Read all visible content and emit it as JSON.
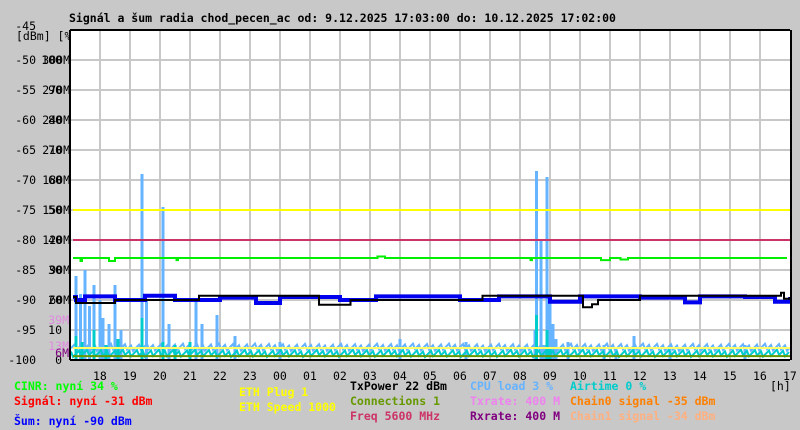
{
  "title": "Signál a šum radia chod_pecen_ac od: 9.12.2025 17:03:00 do: 10.12.2025 17:02:00",
  "chart_data": {
    "type": "line",
    "title": "Signál a šum radia chod_pecen_ac od: 9.12.2025 17:03:00 do: 10.12.2025 17:02:00",
    "y_unit_label": "[dBm] [%]",
    "x_unit_label": "[h]",
    "ylim_dbm": [
      -100,
      -45
    ],
    "ylim_percent": [
      0,
      100
    ],
    "grid": true,
    "y_ticks": [
      {
        "dbm": "-45",
        "pct": "",
        "rate": ""
      },
      {
        "dbm": "-50",
        "pct": "100",
        "rate": "300M"
      },
      {
        "dbm": "-55",
        "pct": "90",
        "rate": "270M"
      },
      {
        "dbm": "-60",
        "pct": "80",
        "rate": "240M"
      },
      {
        "dbm": "-65",
        "pct": "70",
        "rate": "210M"
      },
      {
        "dbm": "-70",
        "pct": "60",
        "rate": "180M"
      },
      {
        "dbm": "-75",
        "pct": "50",
        "rate": "150M"
      },
      {
        "dbm": "-80",
        "pct": "40",
        "rate": "120M"
      },
      {
        "dbm": "-85",
        "pct": "30",
        "rate": "90M"
      },
      {
        "dbm": "-90",
        "pct": "20",
        "rate": "60M"
      },
      {
        "dbm": "-95",
        "pct": "10",
        "rate": ""
      },
      {
        "dbm": "-100",
        "pct": "0",
        "rate": ""
      }
    ],
    "extra_rate_ticks": [
      {
        "label": "39M",
        "pct": 13,
        "color": "#e08ae0"
      },
      {
        "label": "13M",
        "pct": 4.3,
        "color": "#e08ae0"
      },
      {
        "label": "6M",
        "pct": 2,
        "color": "#800080"
      }
    ],
    "x_ticks": [
      "18",
      "19",
      "20",
      "21",
      "22",
      "23",
      "00",
      "01",
      "02",
      "03",
      "04",
      "05",
      "06",
      "07",
      "08",
      "09",
      "10",
      "11",
      "12",
      "13",
      "14",
      "15",
      "16",
      "17"
    ],
    "x_start_hour_offset": 0.1,
    "series": [
      {
        "name": "ETH Plug",
        "axis": "dbm",
        "color": "#ffff00",
        "points": [
          [
            0.1,
            -75
          ],
          [
            24,
            -75
          ]
        ]
      },
      {
        "name": "Freq",
        "axis": "dbm",
        "color": "#cc3366",
        "points": [
          [
            0.1,
            -80
          ],
          [
            24,
            -80
          ]
        ]
      },
      {
        "name": "CINR",
        "axis": "pct",
        "color": "#00ee00",
        "points": [
          [
            0.1,
            34
          ],
          [
            0.3,
            34
          ],
          [
            0.35,
            33
          ],
          [
            0.4,
            34
          ],
          [
            1.2,
            34
          ],
          [
            1.3,
            33
          ],
          [
            1.5,
            34
          ],
          [
            3.5,
            34
          ],
          [
            3.55,
            33.3
          ],
          [
            3.6,
            34
          ],
          [
            10.2,
            34
          ],
          [
            10.25,
            34.5
          ],
          [
            10.5,
            34
          ],
          [
            15.3,
            34
          ],
          [
            15.35,
            33.3
          ],
          [
            15.4,
            34
          ],
          [
            17.6,
            34
          ],
          [
            17.7,
            33.3
          ],
          [
            18.0,
            34
          ],
          [
            18.3,
            34
          ],
          [
            18.35,
            33.5
          ],
          [
            18.6,
            34
          ],
          [
            23.9,
            34
          ]
        ]
      },
      {
        "name": "Šum",
        "axis": "dbm",
        "color": "#0000ee",
        "points": [
          [
            0.1,
            -89.5
          ],
          [
            0.2,
            -90
          ],
          [
            0.5,
            -89.4
          ],
          [
            1.5,
            -90
          ],
          [
            2.5,
            -89.3
          ],
          [
            3.5,
            -90
          ],
          [
            5.0,
            -89.6
          ],
          [
            6.2,
            -90.5
          ],
          [
            7.0,
            -89.5
          ],
          [
            9.0,
            -90
          ],
          [
            10.2,
            -89.4
          ],
          [
            12.5,
            -89.4
          ],
          [
            13.0,
            -90
          ],
          [
            14.3,
            -89.4
          ],
          [
            16.0,
            -90.3
          ],
          [
            17.0,
            -89.4
          ],
          [
            19.0,
            -89.6
          ],
          [
            20.5,
            -90.4
          ],
          [
            21.0,
            -89.4
          ],
          [
            22.5,
            -89.5
          ],
          [
            23.5,
            -90.3
          ],
          [
            24,
            -89.5
          ]
        ]
      },
      {
        "name": "TxPower",
        "axis": "dbm",
        "color": "#000000",
        "points": [
          [
            0.1,
            -89.5
          ],
          [
            0.2,
            -90.5
          ],
          [
            1.0,
            -90.5
          ],
          [
            1.5,
            -90
          ],
          [
            3.5,
            -90
          ],
          [
            4.3,
            -89.3
          ],
          [
            8.2,
            -89.3
          ],
          [
            8.3,
            -90.8
          ],
          [
            9.3,
            -90.8
          ],
          [
            9.35,
            -90
          ],
          [
            13.7,
            -90
          ],
          [
            13.75,
            -89.3
          ],
          [
            17.0,
            -89.3
          ],
          [
            17.1,
            -91.2
          ],
          [
            17.4,
            -90.7
          ],
          [
            17.6,
            -90
          ],
          [
            18.8,
            -90
          ],
          [
            19.0,
            -89.3
          ],
          [
            23.6,
            -89.3
          ],
          [
            23.7,
            -88.8
          ],
          [
            23.8,
            -89.8
          ],
          [
            24,
            -89.5
          ]
        ]
      },
      {
        "name": "Connections",
        "axis": "pct",
        "color": "#669900",
        "points": [
          [
            0.1,
            1.3
          ],
          [
            24,
            1.3
          ]
        ]
      },
      {
        "name": "ETH Speed",
        "axis": "pct",
        "color": "#ffff66",
        "points": [
          [
            0.1,
            4
          ],
          [
            24,
            4
          ]
        ]
      }
    ],
    "bars": [
      {
        "name": "CPU load",
        "color": "#66b3ff",
        "baseline": 3,
        "spikes": [
          [
            0.2,
            28
          ],
          [
            0.35,
            22
          ],
          [
            0.5,
            30
          ],
          [
            0.65,
            18
          ],
          [
            0.8,
            25
          ],
          [
            1.0,
            20
          ],
          [
            1.1,
            14
          ],
          [
            1.3,
            12
          ],
          [
            1.5,
            25
          ],
          [
            1.7,
            10
          ],
          [
            2.4,
            62
          ],
          [
            2.55,
            20
          ],
          [
            3.1,
            51
          ],
          [
            3.3,
            12
          ],
          [
            4.2,
            20
          ],
          [
            4.4,
            12
          ],
          [
            4.9,
            15
          ],
          [
            5.5,
            8
          ],
          [
            7.0,
            6
          ],
          [
            11.0,
            7
          ],
          [
            13.2,
            6
          ],
          [
            15.5,
            8
          ],
          [
            15.8,
            5
          ],
          [
            15.5,
            10
          ],
          [
            16.2,
            7
          ],
          [
            16.6,
            6
          ],
          [
            15.9,
            4
          ],
          [
            17.8,
            5
          ],
          [
            18.2,
            4
          ],
          [
            15.55,
            63
          ],
          [
            15.7,
            40
          ],
          [
            15.9,
            61
          ],
          [
            16.0,
            20
          ],
          [
            16.1,
            12
          ],
          [
            18.8,
            8
          ],
          [
            20.0,
            5
          ],
          [
            22.5,
            5
          ]
        ]
      },
      {
        "name": "Airtime",
        "color": "#00cccc",
        "baseline": 1,
        "spikes": [
          [
            0.2,
            8
          ],
          [
            0.4,
            6
          ],
          [
            0.8,
            10
          ],
          [
            1.2,
            5
          ],
          [
            1.6,
            7
          ],
          [
            2.4,
            14
          ],
          [
            3.1,
            6
          ],
          [
            3.5,
            5
          ],
          [
            4.0,
            6
          ],
          [
            15.55,
            15
          ],
          [
            15.9,
            10
          ],
          [
            16.0,
            4
          ]
        ]
      }
    ]
  },
  "legend": {
    "cinr": "CINR: nyní 34 %",
    "signal": "Signál: nyní -31 dBm",
    "noise": "Šum: nyní -90 dBm",
    "eth_plug": "ETH Plug 1",
    "eth_speed": "ETH Speed 1000",
    "txpower": "TxPower 22 dBm",
    "connections": "Connections 1",
    "freq": "Freq 5600 MHz",
    "cpu": "CPU load 3 %",
    "txrate": "Txrate: 400 M",
    "rxrate": "Rxrate: 400 M",
    "airtime": "Airtime 0 %",
    "chain0": "Chain0 signal -35 dBm",
    "chain1": "Chain1 signal -34 dBm"
  },
  "colors": {
    "cinr": "#00ff00",
    "signal": "#ff0000",
    "noise": "#0000ff",
    "eth": "#ffff00",
    "txpower": "#000000",
    "connections": "#669900",
    "freq": "#cc3366",
    "cpu": "#66b3ff",
    "txrate": "#ee82ee",
    "rxrate": "#800080",
    "airtime": "#00cccc",
    "chain0": "#ff8000",
    "chain1": "#ffb080"
  }
}
